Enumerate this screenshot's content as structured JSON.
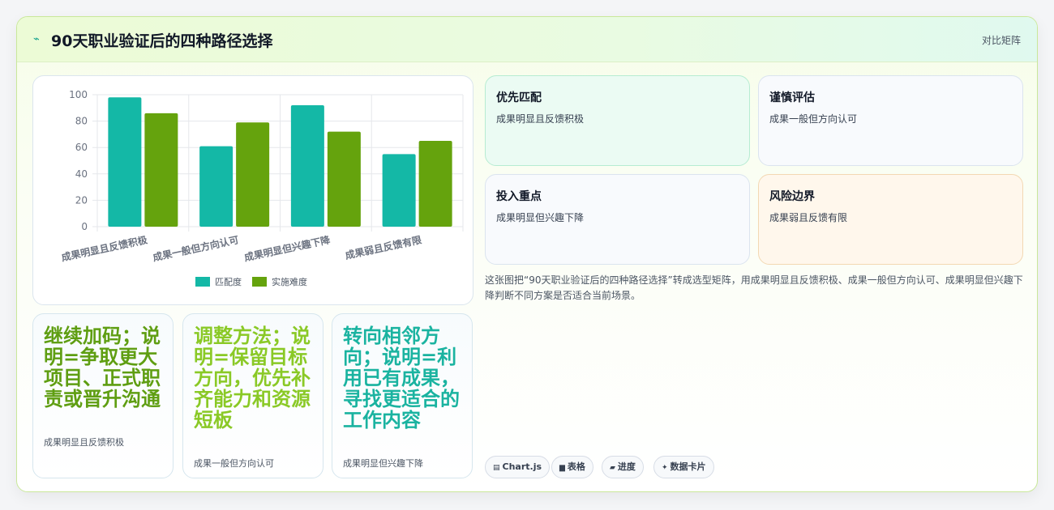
{
  "header": {
    "icon": "lightning-icon",
    "title": "90天职业验证后的四种路径选择",
    "link": "对比矩阵"
  },
  "chart_data": {
    "type": "bar",
    "categories": [
      "成果明显且反馈积极",
      "成果一般但方向认可",
      "成果明显但兴趣下降",
      "成果弱且反馈有限"
    ],
    "series": [
      {
        "name": "匹配度",
        "values": [
          98,
          61,
          92,
          55
        ],
        "color": "#14b8a6"
      },
      {
        "name": "实施难度",
        "values": [
          86,
          79,
          72,
          65
        ],
        "color": "#65a30d"
      }
    ],
    "ylim": [
      0,
      100
    ],
    "yticks": [
      0,
      20,
      40,
      60,
      80,
      100
    ],
    "legend": "bottom",
    "grid": true
  },
  "quadrants": [
    {
      "title": "优先匹配",
      "desc": "成果明显且反馈积极"
    },
    {
      "title": "谨慎评估",
      "desc": "成果一般但方向认可"
    },
    {
      "title": "投入重点",
      "desc": "成果明显但兴趣下降"
    },
    {
      "title": "风险边界",
      "desc": "成果弱且反馈有限"
    }
  ],
  "description": "这张图把“90天职业验证后的四种路径选择”转成选型矩阵，用成果明显且反馈积极、成果一般但方向认可、成果明显但兴趣下降判断不同方案是否适合当前场景。",
  "stats": [
    {
      "value": "继续加码；说明=争取更大项目、正式职责或晋升沟通",
      "label": "成果明显且反馈积极"
    },
    {
      "value": "调整方法；说明=保留目标方向，优先补齐能力和资源短板",
      "label": "成果一般但方向认可"
    },
    {
      "value": "转向相邻方向；说明=利用已有成果，寻找更适合的工作内容",
      "label": "成果明显但兴趣下降"
    }
  ],
  "chips": [
    {
      "icon": "chart-icon",
      "glyph": "▤",
      "label": "Chart.js"
    },
    {
      "icon": "table-icon",
      "glyph": "▆",
      "label": "表格"
    },
    {
      "icon": "progress-icon",
      "glyph": "▰",
      "label": "进度"
    },
    {
      "icon": "sparkle-icon",
      "glyph": "✦",
      "label": "数据卡片"
    }
  ]
}
